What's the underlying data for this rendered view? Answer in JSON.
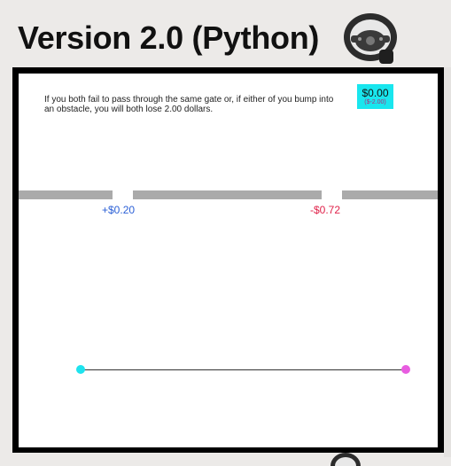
{
  "header": {
    "title": "Version 2.0 (Python)",
    "icon": "steering-wheel-icon"
  },
  "game": {
    "instruction": "If you both fail to pass through the same gate or, if either of you bump into an obstacle, you will both lose 2.00 dollars.",
    "balance": {
      "value": "$0.00",
      "penalty": "($-2.00)",
      "color": "#19e6ee"
    },
    "gates": [
      {
        "label": "+$0.20",
        "color": "#2a5fd6"
      },
      {
        "label": "-$0.72",
        "color": "#e0224a"
      }
    ],
    "players": [
      {
        "color": "#1ee3ee"
      },
      {
        "color": "#e85ce0"
      }
    ]
  }
}
